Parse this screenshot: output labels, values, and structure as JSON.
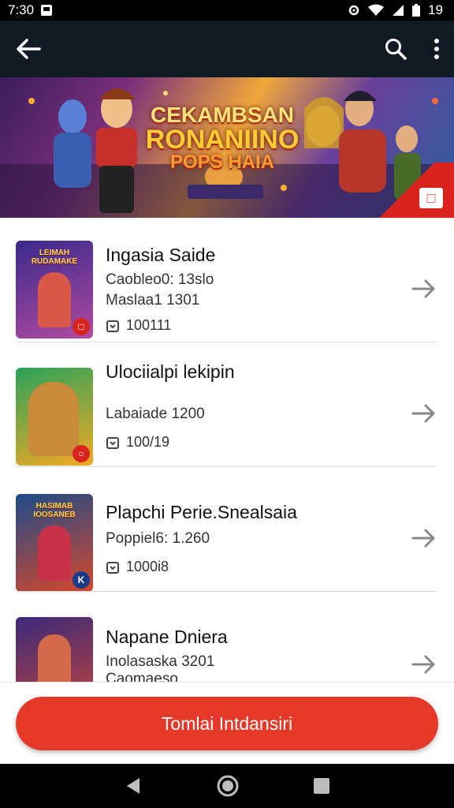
{
  "status_bar": {
    "time": "7:30",
    "battery_level": "19"
  },
  "banner": {
    "line1": "CEKAMBSAN",
    "line2": "RONANIINO",
    "line3": "POPS HAIA"
  },
  "items": [
    {
      "title": "Ingasia Saide",
      "sub1": "Caobleo0: 13slo",
      "sub2": "Maslaa1 1301",
      "meta": "100111",
      "thumb_label": "LEIMAH\nRUDAMAKE",
      "thumb_colors": [
        "#3a2a8c",
        "#b14aa0"
      ]
    },
    {
      "title": "Ulociialpi lekipin",
      "sub1": "Labaiade 1200",
      "sub2": "",
      "meta": "100/19",
      "thumb_label": "",
      "thumb_colors": [
        "#2aa35a",
        "#f4a823"
      ]
    },
    {
      "title": "Plapchi Perie.Snealsaia",
      "sub1": "Poppiel6: 1.260",
      "sub2": "",
      "meta": "1000i8",
      "thumb_label": "HASIMAB\nIOOSANEB",
      "thumb_colors": [
        "#1d4b8a",
        "#d6482a"
      ]
    },
    {
      "title": "Napane Dniera",
      "sub1": "Inolasaska 3201",
      "sub2": "Caomaeso",
      "meta": "",
      "thumb_label": "",
      "thumb_colors": [
        "#3b2a7a",
        "#c2433a"
      ]
    }
  ],
  "cta_label": "Tomlai Intdansiri",
  "colors": {
    "accent": "#e53a29",
    "app_bar": "#111a22"
  }
}
